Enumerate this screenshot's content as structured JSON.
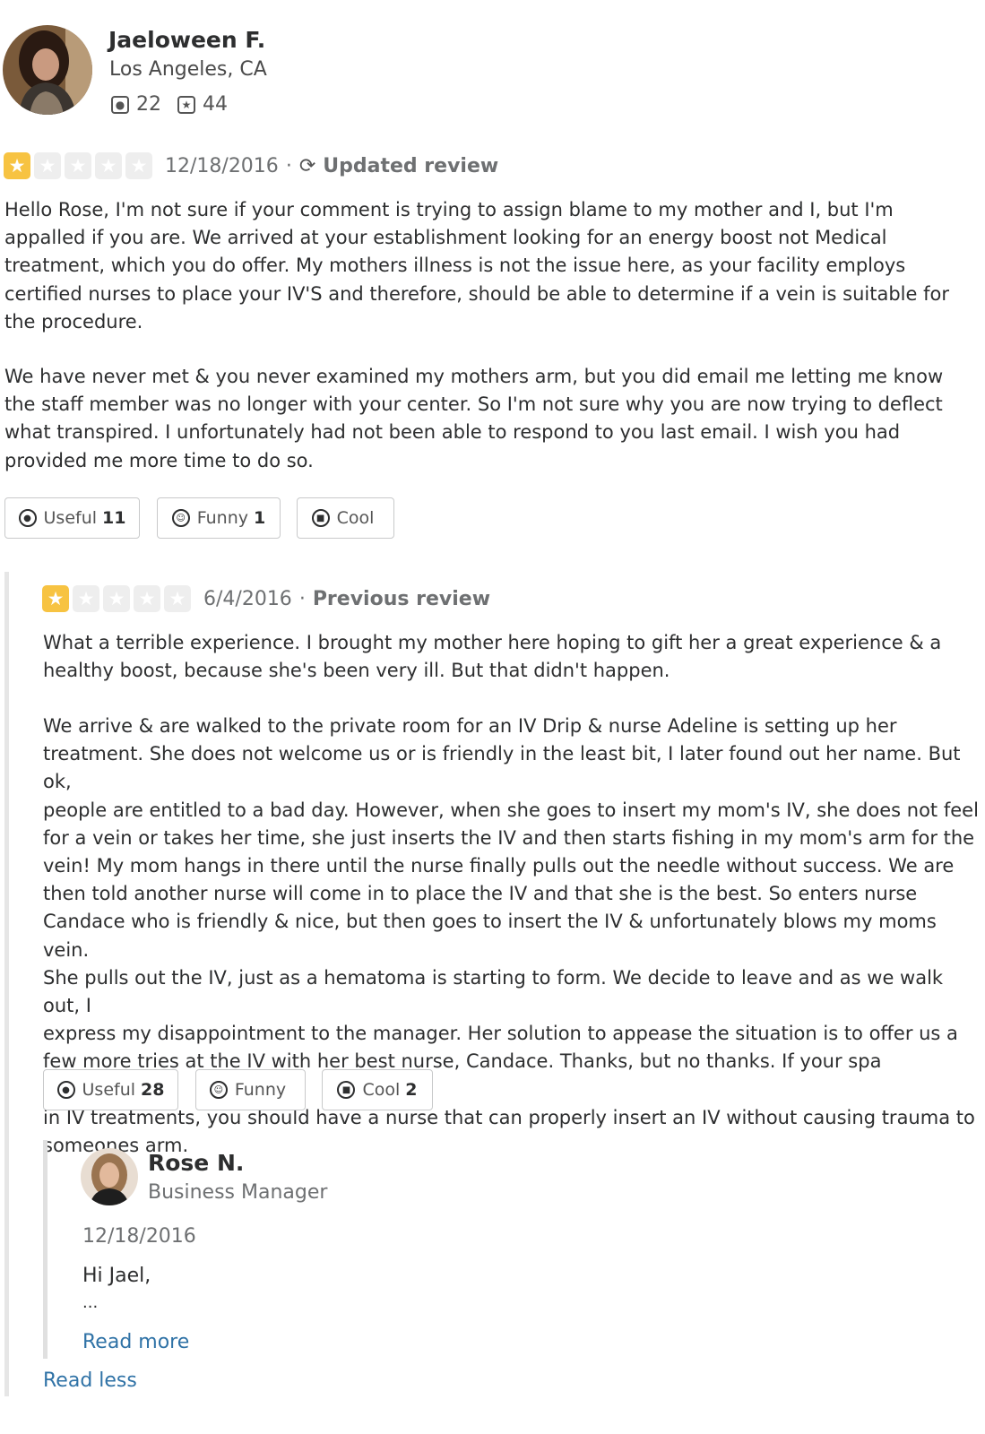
{
  "user": {
    "name": "Jaeloween F.",
    "location": "Los Angeles, CA",
    "friends_icon": "friends-icon",
    "friends_count": "22",
    "reviews_icon": "star-badge-icon",
    "reviews_count": "44"
  },
  "current_review": {
    "rating": 1,
    "rating_max": 5,
    "date": "12/18/2016",
    "separator": "·",
    "status": "Updated review",
    "paragraphs": [
      "Hello Rose, I'm not sure if your comment is trying to assign blame to my mother and I, but I'm\nappalled if you are. We arrived at your establishment looking for an energy boost not Medical\ntreatment, which you do offer. My mothers illness is not the issue here, as your facility employs\ncertified nurses to place your IV'S and therefore, should be able to determine if a vein is suitable for\nthe procedure.",
      "We have never met & you never examined my mothers arm, but you did email me letting me know\nthe staff member was no longer with your center. So I'm not sure why you are now trying to deflect\nwhat transpired. I unfortunately had not been able to respond to you last email. I wish you had\nprovided me more time to do so."
    ],
    "votes": {
      "useful_label": "Useful",
      "useful_count": "11",
      "funny_label": "Funny",
      "funny_count": "1",
      "cool_label": "Cool",
      "cool_count": ""
    }
  },
  "previous_review": {
    "rating": 1,
    "rating_max": 5,
    "date": "6/4/2016",
    "separator": "·",
    "status": "Previous review",
    "paragraphs": [
      "What a terrible experience. I brought my mother here hoping to gift her a great experience & a\nhealthy boost, because she's been very ill. But that didn't happen.",
      "We arrive & are walked to the private room for an IV Drip & nurse Adeline is setting up her\ntreatment. She does not welcome us or is friendly in the least bit, I later found out her name. But ok,\npeople are entitled to a bad day. However, when she goes to insert my mom's IV, she does not feel\nfor a vein or takes her time, she just inserts the IV and then starts fishing in my mom's arm for the\nvein! My mom hangs in there until the nurse finally pulls out the needle without success. We are\nthen told another nurse will come in to place the IV and that she is the best. So enters nurse\nCandace who is friendly & nice, but then goes to insert the IV & unfortunately blows my moms vein.\nShe pulls out the IV, just as a hematoma is starting to form. We decide to leave and as we walk out, I\nexpress my disappointment to the manager. Her solution to appease the situation is to offer us a\nfew more tries at the IV with her best nurse, Candace. Thanks, but no thanks. If your spa specializes\nin IV treatments, you should have a nurse that can properly insert an IV without causing trauma to\nsomeones arm."
    ],
    "votes": {
      "useful_label": "Useful",
      "useful_count": "28",
      "funny_label": "Funny",
      "funny_count": "",
      "cool_label": "Cool",
      "cool_count": "2"
    }
  },
  "owner_reply": {
    "name": "Rose N.",
    "role": "Business Manager",
    "date": "12/18/2016",
    "text": "Hi Jael,",
    "ellipsis": "...",
    "read_more": "Read more"
  },
  "read_less": "Read less",
  "colors": {
    "star_on": "#f7c342",
    "star_off": "#eeeeee",
    "link": "#2f72a6"
  }
}
